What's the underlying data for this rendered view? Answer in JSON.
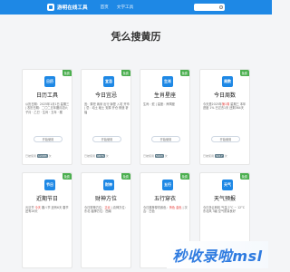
{
  "header": {
    "brand": "游明在线工具",
    "nav": [
      "首页",
      "文学工具"
    ]
  },
  "page": {
    "title": "凭么搜黄历"
  },
  "cards": [
    {
      "title": "日历工具",
      "badge": "免费",
      "icon_text": "日历",
      "desc": "公历日期：2025年1月1日 星期三 | 农历日期：二〇二五年腊月初六 子月 · 乙巳 · 生肖 · 五年 · 猴",
      "highlight": "",
      "button": "开始使用",
      "foot_label": "已被使用",
      "foot_count": "12483",
      "foot_unit": "次"
    },
    {
      "title": "今日宜忌",
      "badge": "免费",
      "icon_text": "宜忌",
      "desc": "宜：祭祀 纳采 出行 嫁娶 入宅 开市 | 忌：动土 破土 安葬 开仓 修造 祈福",
      "highlight": "",
      "button": "开始使用",
      "foot_label": "已被使用",
      "foot_count": "9876",
      "foot_unit": "次"
    },
    {
      "title": "生肖星座",
      "badge": "免费",
      "icon_text": "生肖",
      "desc": "生肖：蛇 | 星座：摩羯座",
      "highlight": "",
      "button": "开始使用",
      "foot_label": "已被使用",
      "foot_count": "5043",
      "foot_unit": "次"
    },
    {
      "title": "今日周数",
      "badge": "免费",
      "icon_text": "周数",
      "desc": "今天是2025年第1周 星期三 本年进度 1% 已过去1天 还剩364天",
      "highlight": "第1周",
      "button": "开始使用",
      "foot_label": "已被使用",
      "foot_count": "3217",
      "foot_unit": "次"
    },
    {
      "title": "近期节日",
      "badge": "免费",
      "icon_text": "节日",
      "desc": "元旦节 今天 腊八节 还有6天 春节 还有28天",
      "highlight": "今天",
      "button": "开始使用",
      "foot_label": "已被使用",
      "foot_count": "7702",
      "foot_unit": "次"
    },
    {
      "title": "财神方位",
      "badge": "免费",
      "icon_text": "财神",
      "desc": "今日财神方位：正北 | 喜神方位：东北 福神方位：西南",
      "highlight": "正北",
      "button": "开始使用",
      "foot_label": "已被使用",
      "foot_count": "6541",
      "foot_unit": "次"
    },
    {
      "title": "五行穿衣",
      "badge": "免费",
      "icon_text": "五行",
      "desc": "今日推荐穿衣颜色：黄色 金色 | 次吉：白色",
      "highlight": "黄色 金色",
      "button": "开始使用",
      "foot_label": "已被使用",
      "foot_count": "4128",
      "foot_unit": "次"
    },
    {
      "title": "天气预报",
      "badge": "免费",
      "icon_text": "天气",
      "desc": "今日多云转晴 气温 2°C ~ 12°C 东北风 3级 空气质量良好",
      "highlight": "",
      "button": "开始使用",
      "foot_label": "已被使用",
      "foot_count": "8830",
      "foot_unit": "次"
    }
  ],
  "watermark": {
    "text": "秒收录啦msl"
  },
  "colors": {
    "primary": "#1e88e5",
    "badge": "#4caf50",
    "highlight": "#e53935"
  }
}
